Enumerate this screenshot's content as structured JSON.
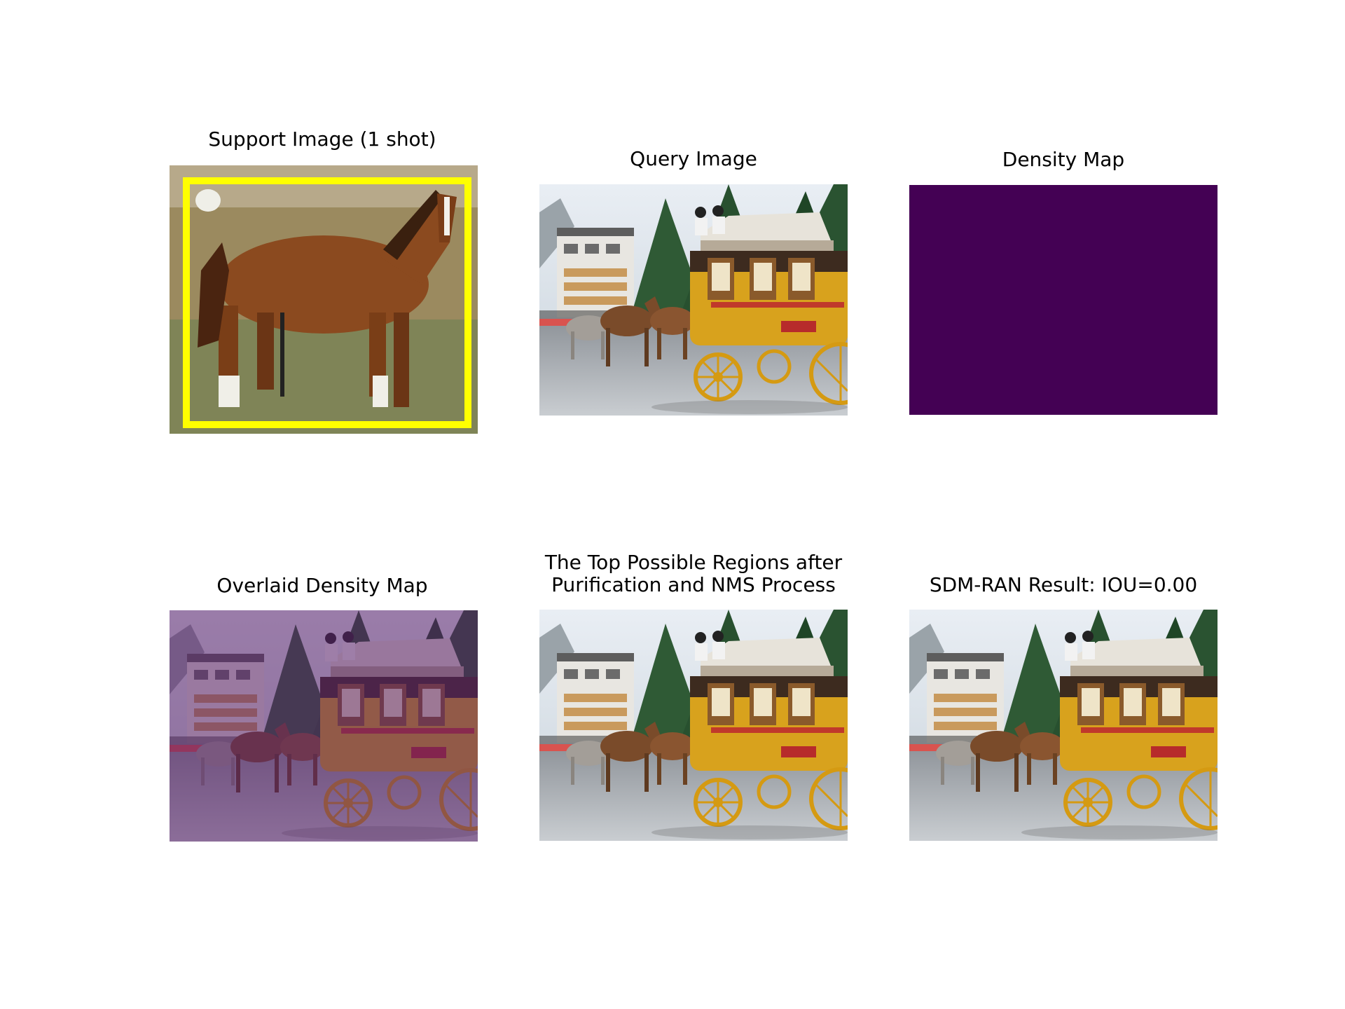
{
  "figure": {
    "panels": [
      {
        "id": "support",
        "title": "Support Image (1 shot)"
      },
      {
        "id": "query",
        "title": "Query Image"
      },
      {
        "id": "density",
        "title": "Density Map"
      },
      {
        "id": "overlaid",
        "title": "Overlaid Density Map"
      },
      {
        "id": "regions",
        "title_line1": "The Top Possible Regions after",
        "title_line2": "Purification and NMS Process"
      },
      {
        "id": "result",
        "title": "SDM-RAN Result: IOU=0.00"
      }
    ],
    "colors": {
      "density_fill": "#440154",
      "support_box": "#ffff00",
      "overlay_tint": "#7b3f8a"
    }
  }
}
